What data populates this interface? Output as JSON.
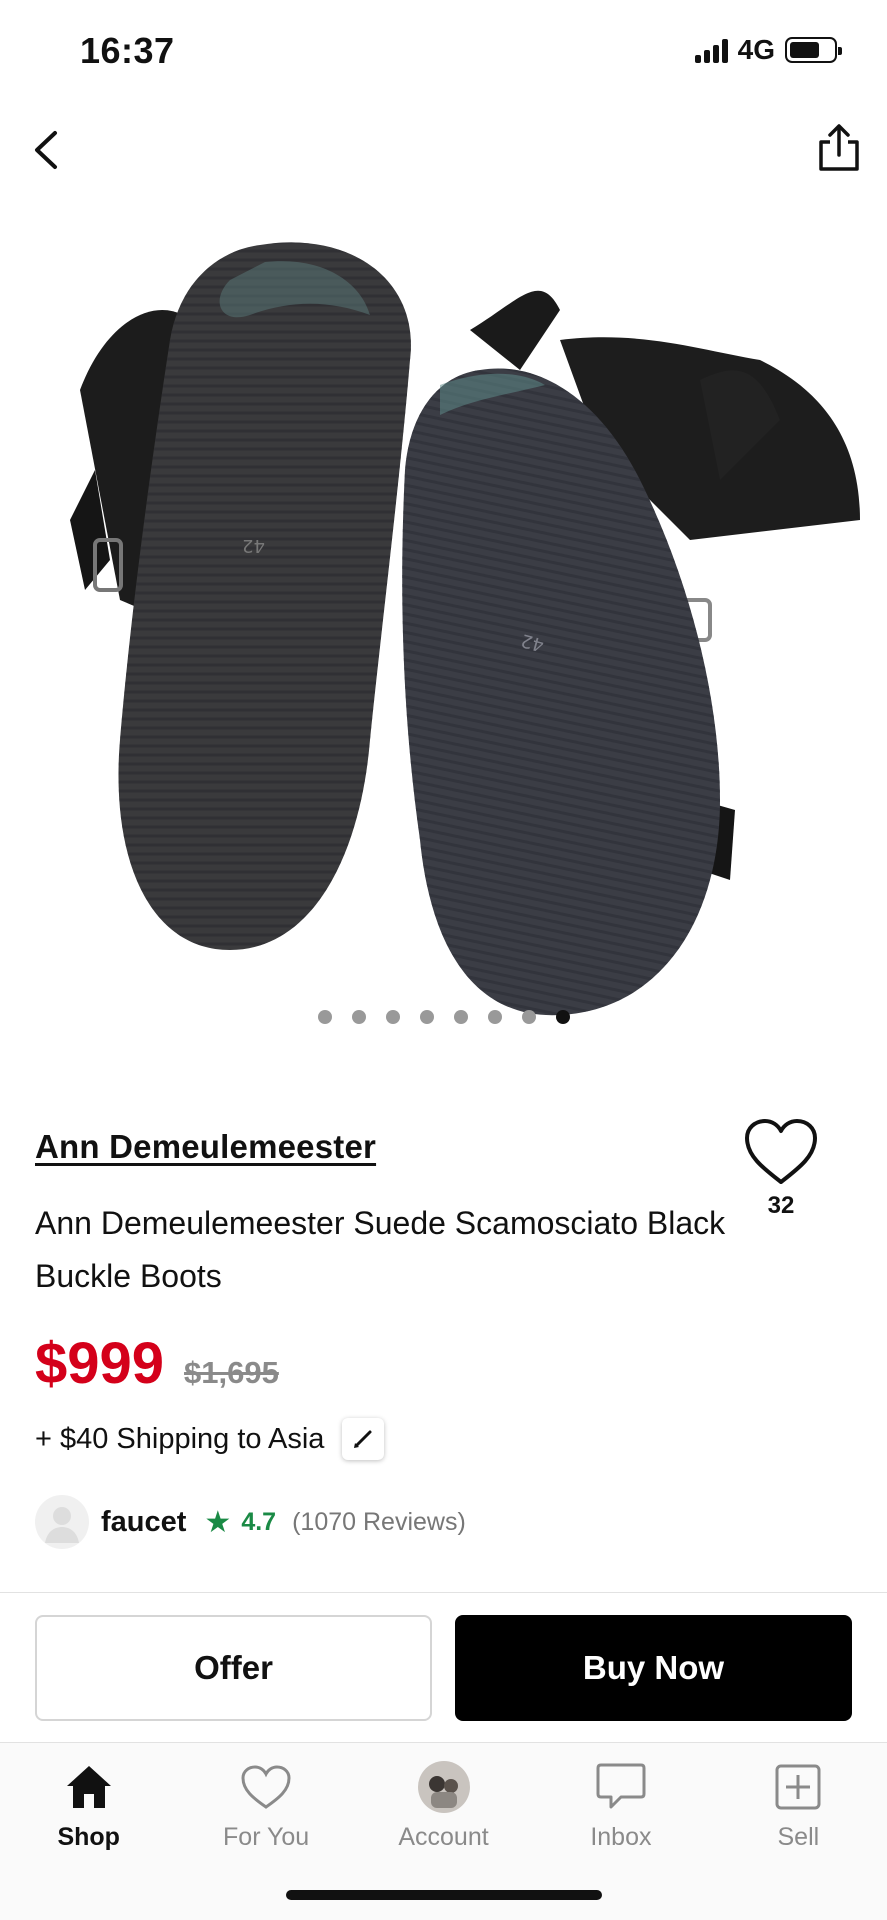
{
  "status_bar": {
    "time": "16:37",
    "network": "4G"
  },
  "product": {
    "brand": "Ann Demeulemeester",
    "title": "Ann Demeulemeester Suede Scamosciato Black Buckle Boots",
    "likes": "32",
    "price": "$999",
    "original_price": "$1,695",
    "shipping": "+ $40 Shipping to Asia",
    "image_count": 8,
    "active_image_index": 8
  },
  "seller": {
    "name": "faucet",
    "star": "★",
    "rating": "4.7",
    "reviews": "(1070 Reviews)"
  },
  "actions": {
    "offer_label": "Offer",
    "buy_label": "Buy Now"
  },
  "tabs": [
    {
      "label": "Shop",
      "icon": "home-icon",
      "active": true
    },
    {
      "label": "For You",
      "icon": "heart-icon",
      "active": false
    },
    {
      "label": "Account",
      "icon": "avatar-icon",
      "active": false
    },
    {
      "label": "Inbox",
      "icon": "chat-icon",
      "active": false
    },
    {
      "label": "Sell",
      "icon": "plus-square-icon",
      "active": false
    }
  ],
  "colors": {
    "price": "#d4001a",
    "rating": "#1a8a45",
    "buy_button": "#000000"
  }
}
